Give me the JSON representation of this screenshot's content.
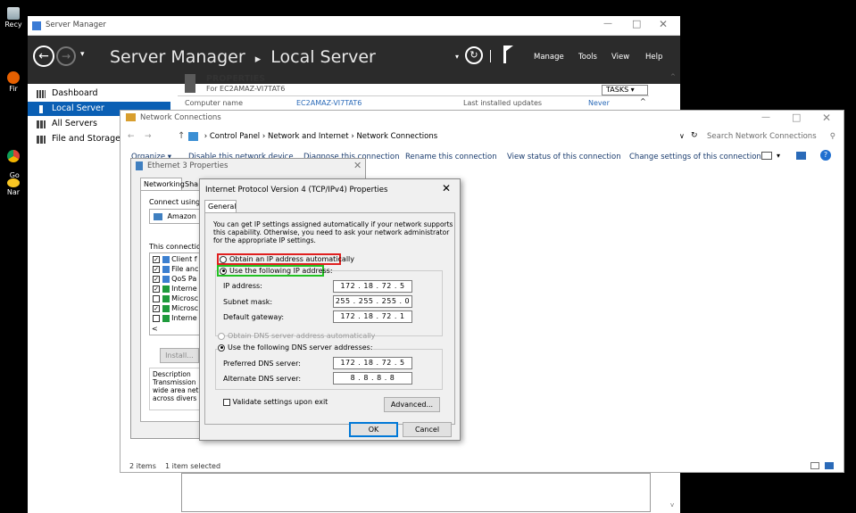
{
  "desktop": {
    "icons": [
      {
        "label": "Recy"
      },
      {
        "label": "Fir"
      },
      {
        "label": "Go\nChr"
      },
      {
        "label": "Nar"
      }
    ]
  },
  "server_manager": {
    "window_title": "Server Manager",
    "breadcrumb_root": "Server Manager",
    "breadcrumb_sep": "▸",
    "breadcrumb_page": "Local Server",
    "menu": [
      "Manage",
      "Tools",
      "View",
      "Help"
    ],
    "sidebar": [
      {
        "label": "Dashboard"
      },
      {
        "label": "Local Server"
      },
      {
        "label": "All Servers"
      },
      {
        "label": "File and Storage S"
      }
    ],
    "properties_title": "PROPERTIES",
    "properties_for": "For EC2AMAZ-VI7TAT6",
    "tasks_label": "TASKS",
    "row_label": "Computer name",
    "row_value": "EC2AMAZ-VI7TAT6",
    "row2_label": "Last installed updates",
    "row2_value": "Never"
  },
  "network_connections": {
    "title": "Network Connections",
    "address": [
      "Control Panel",
      "Network and Internet",
      "Network Connections"
    ],
    "search_placeholder": "Search Network Connections",
    "toolbar": [
      "Organize ▾",
      "Disable this network device",
      "Diagnose this connection",
      "Rename this connection",
      "View status of this connection",
      "Change settings of this connection"
    ],
    "status_items": "2 items",
    "status_selected": "1 item selected"
  },
  "ethernet_props": {
    "title": "Ethernet 3 Properties",
    "tabs": [
      "Networking",
      "Sha"
    ],
    "connect_using": "Connect using:",
    "adapter": "Amazon E",
    "this_connection": "This connection",
    "items": [
      {
        "label": "Client f",
        "checked": true
      },
      {
        "label": "File anc",
        "checked": true
      },
      {
        "label": "QoS Pa",
        "checked": true
      },
      {
        "label": "Interne",
        "checked": true
      },
      {
        "label": "Microsc",
        "checked": false
      },
      {
        "label": "Microsc",
        "checked": true
      },
      {
        "label": "Interne",
        "checked": false
      }
    ],
    "install": "Install...",
    "description_title": "Description",
    "description_lines": [
      "Transmission",
      "wide area net",
      "across divers"
    ]
  },
  "ipv4": {
    "title": "Internet Protocol Version 4 (TCP/IPv4) Properties",
    "tab": "General",
    "intro_lines": [
      "You can get IP settings assigned automatically if your network supports",
      "this capability. Otherwise, you need to ask your network administrator",
      "for the appropriate IP settings."
    ],
    "obtain_auto": "Obtain an IP address automatically",
    "use_following": "Use the following IP address:",
    "ip_label": "IP address:",
    "ip_value": "172 . 18 . 72 . 5",
    "subnet_label": "Subnet mask:",
    "subnet_value": "255 . 255 . 255 . 0",
    "gateway_label": "Default gateway:",
    "gateway_value": "172 . 18 . 72 . 1",
    "dns_auto": "Obtain DNS server address automatically",
    "dns_use": "Use the following DNS server addresses:",
    "pref_dns_label": "Preferred DNS server:",
    "pref_dns_value": "172 . 18 . 72 . 5",
    "alt_dns_label": "Alternate DNS server:",
    "alt_dns_value": "8 . 8 . 8 . 8",
    "validate": "Validate settings upon exit",
    "advanced": "Advanced...",
    "ok": "OK",
    "cancel": "Cancel",
    "highlight_red": "#e02020",
    "highlight_green": "#22c122"
  }
}
